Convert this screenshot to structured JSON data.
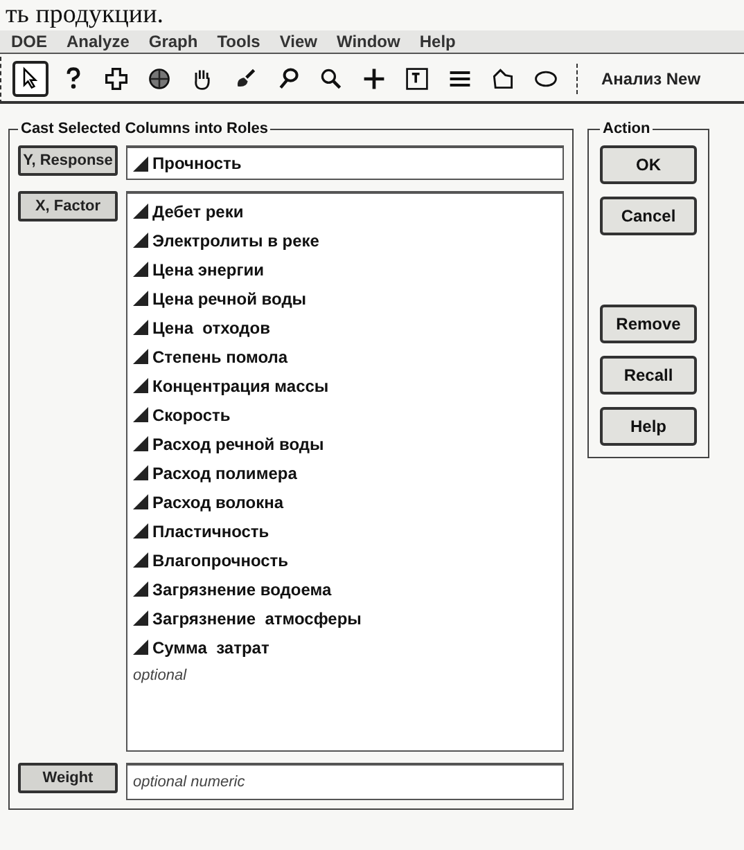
{
  "page_caption": "ть продукции.",
  "menu": [
    "DOE",
    "Analyze",
    "Graph",
    "Tools",
    "View",
    "Window",
    "Help"
  ],
  "toolbar": {
    "tools": [
      {
        "kind": "arrow",
        "selected": true
      },
      {
        "kind": "help",
        "selected": false
      },
      {
        "kind": "crosshair",
        "selected": false
      },
      {
        "kind": "globe",
        "selected": false
      },
      {
        "kind": "hand",
        "selected": false
      },
      {
        "kind": "brush",
        "selected": false
      },
      {
        "kind": "lasso",
        "selected": false
      },
      {
        "kind": "magnifier",
        "selected": false
      },
      {
        "kind": "plus",
        "selected": false
      },
      {
        "kind": "textbox",
        "selected": false
      },
      {
        "kind": "lines",
        "selected": false
      },
      {
        "kind": "polygon",
        "selected": false
      },
      {
        "kind": "ellipse",
        "selected": false
      }
    ],
    "title": "Анализ New"
  },
  "cast_panel": {
    "title": "Cast Selected Columns into Roles",
    "roles": [
      {
        "kind": "y",
        "button": "Y, Response",
        "columns": [
          "Прочность"
        ]
      },
      {
        "kind": "x",
        "button": "X, Factor",
        "columns": [
          "Дебет реки",
          "Электролиты в реке",
          "Цена энергии",
          "Цена речной воды",
          "Цена  отходов",
          "Степень помола",
          "Концентрация массы",
          "Скорость",
          "Расход речной воды",
          "Расход полимера",
          "Расход волокна",
          "Пластичность",
          "Влагопрочность",
          "Загрязнение водоема",
          "Загрязнение  атмосферы",
          "Сумма  затрат"
        ],
        "placeholder": "optional"
      },
      {
        "kind": "weight",
        "button": "Weight",
        "placeholder": "optional numeric"
      }
    ]
  },
  "action_panel": {
    "title": "Action",
    "button_groups": [
      [
        "OK",
        "Cancel"
      ],
      [
        "Remove",
        "Recall",
        "Help"
      ]
    ]
  }
}
